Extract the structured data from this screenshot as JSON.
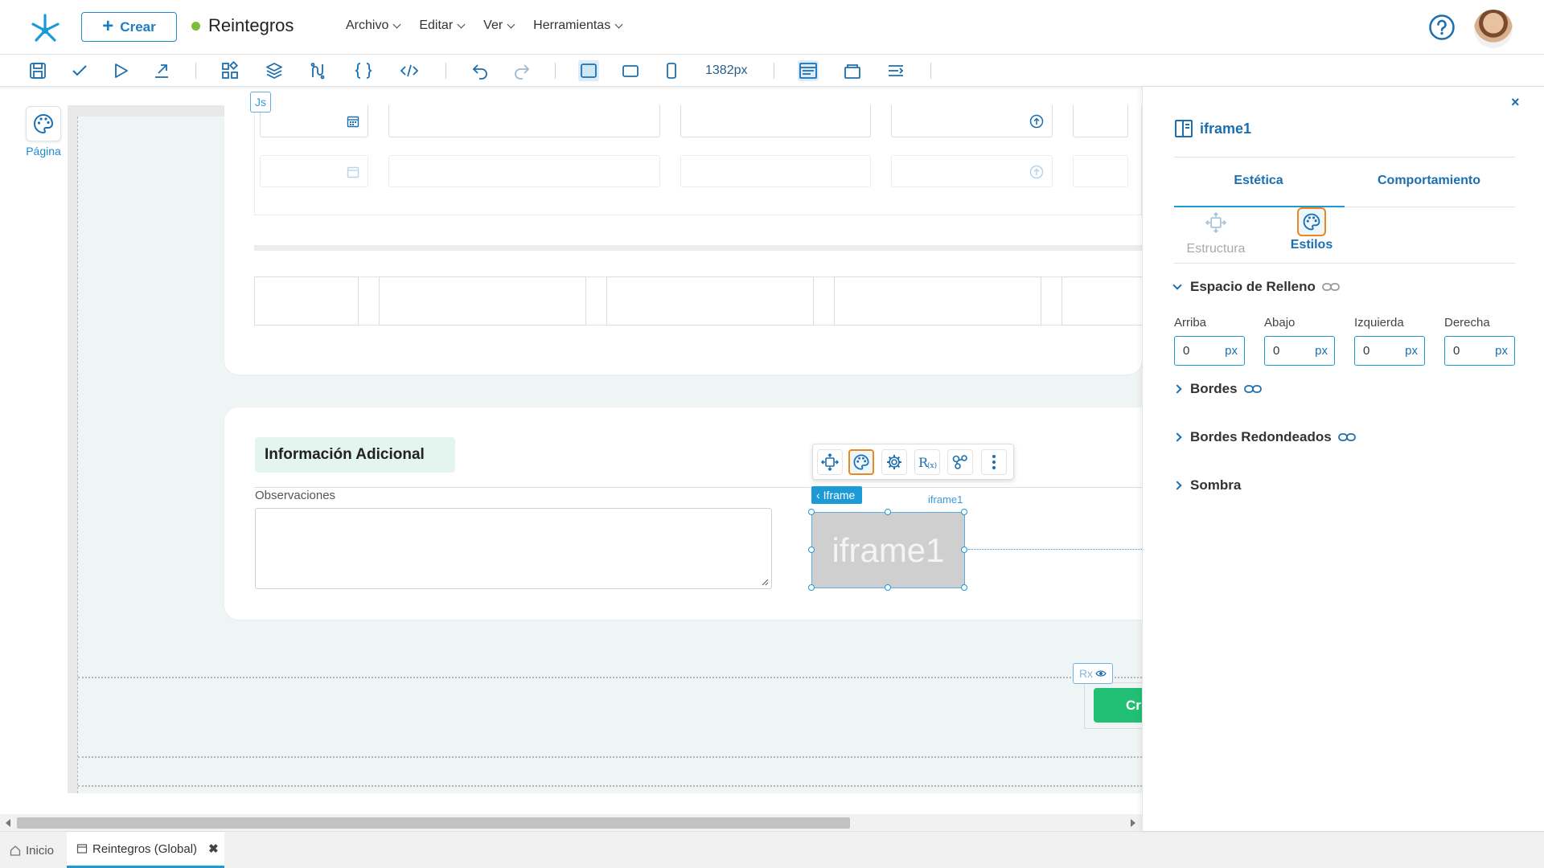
{
  "header": {
    "create_label": "Crear",
    "app_title": "Reintegros",
    "menu": [
      "Archivo",
      "Editar",
      "Ver",
      "Herramientas"
    ]
  },
  "toolbar": {
    "width_readout": "1382px"
  },
  "canvas": {
    "js_tag": "Js",
    "page_button_label": "Página",
    "section_title": "Información Adicional",
    "observations_label": "Observaciones",
    "iframe_tag": "Iframe",
    "iframe_name": "iframe1",
    "iframe_placeholder": "iframe1",
    "rx_chip": "Rx",
    "green_button_label": "Cr"
  },
  "bottom_tabs": [
    {
      "label": "Inicio",
      "active": false
    },
    {
      "label": "Reintegros (Global)",
      "active": true
    }
  ],
  "panel": {
    "close": "×",
    "title": "iframe1",
    "tabs": [
      "Estética",
      "Comportamiento"
    ],
    "subtabs": [
      "Estructura",
      "Estilos"
    ],
    "padding_section": "Espacio de Relleno",
    "padding_fields": [
      {
        "label": "Arriba",
        "value": "0",
        "unit": "px"
      },
      {
        "label": "Abajo",
        "value": "0",
        "unit": "px"
      },
      {
        "label": "Izquierda",
        "value": "0",
        "unit": "px"
      },
      {
        "label": "Derecha",
        "value": "0",
        "unit": "px"
      }
    ],
    "collapsed_sections": [
      "Bordes",
      "Bordes Redondeados",
      "Sombra"
    ]
  },
  "colors": {
    "accent": "#1b9ad6",
    "primary_text": "#1b6fb0",
    "green": "#21bf73",
    "active_orange": "#e8891a"
  }
}
